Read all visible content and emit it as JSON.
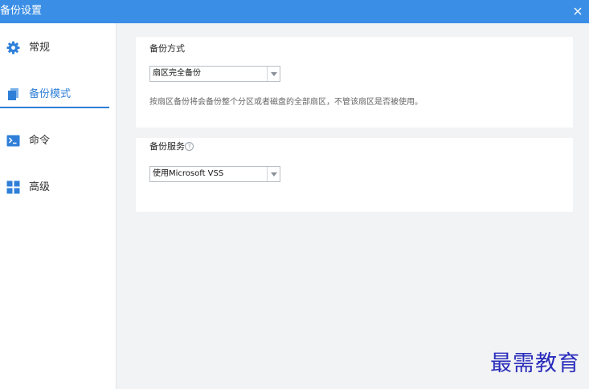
{
  "window": {
    "title": "备份设置"
  },
  "sidebar": {
    "items": [
      {
        "label": "常规",
        "icon": "gear-icon"
      },
      {
        "label": "备份模式",
        "icon": "backup-copy-icon",
        "active": true
      },
      {
        "label": "命令",
        "icon": "terminal-icon"
      },
      {
        "label": "高级",
        "icon": "grid-icon"
      }
    ]
  },
  "backup_method": {
    "title": "备份方式",
    "selected": "扇区完全备份",
    "description": "按扇区备份将会备份整个分区或者磁盘的全部扇区，不管该扇区是否被使用。"
  },
  "backup_service": {
    "title": "备份服务",
    "selected": "使用Microsoft VSS"
  },
  "watermark": "最需教育",
  "colors": {
    "titlebar": "#3a8ee6",
    "accent": "#2f7fd8",
    "background": "#f2f3f5"
  }
}
